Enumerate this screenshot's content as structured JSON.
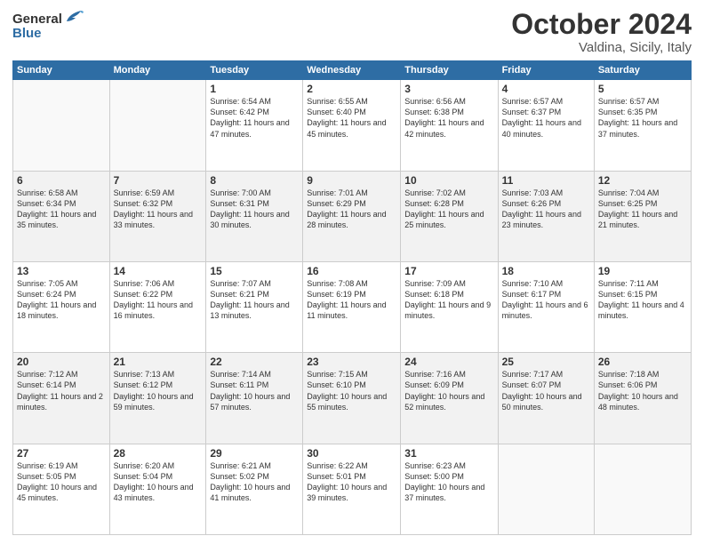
{
  "logo": {
    "general": "General",
    "blue": "Blue"
  },
  "header": {
    "month": "October 2024",
    "location": "Valdina, Sicily, Italy"
  },
  "days_of_week": [
    "Sunday",
    "Monday",
    "Tuesday",
    "Wednesday",
    "Thursday",
    "Friday",
    "Saturday"
  ],
  "weeks": [
    [
      {
        "day": "",
        "content": ""
      },
      {
        "day": "",
        "content": ""
      },
      {
        "day": "1",
        "content": "Sunrise: 6:54 AM\nSunset: 6:42 PM\nDaylight: 11 hours and 47 minutes."
      },
      {
        "day": "2",
        "content": "Sunrise: 6:55 AM\nSunset: 6:40 PM\nDaylight: 11 hours and 45 minutes."
      },
      {
        "day": "3",
        "content": "Sunrise: 6:56 AM\nSunset: 6:38 PM\nDaylight: 11 hours and 42 minutes."
      },
      {
        "day": "4",
        "content": "Sunrise: 6:57 AM\nSunset: 6:37 PM\nDaylight: 11 hours and 40 minutes."
      },
      {
        "day": "5",
        "content": "Sunrise: 6:57 AM\nSunset: 6:35 PM\nDaylight: 11 hours and 37 minutes."
      }
    ],
    [
      {
        "day": "6",
        "content": "Sunrise: 6:58 AM\nSunset: 6:34 PM\nDaylight: 11 hours and 35 minutes."
      },
      {
        "day": "7",
        "content": "Sunrise: 6:59 AM\nSunset: 6:32 PM\nDaylight: 11 hours and 33 minutes."
      },
      {
        "day": "8",
        "content": "Sunrise: 7:00 AM\nSunset: 6:31 PM\nDaylight: 11 hours and 30 minutes."
      },
      {
        "day": "9",
        "content": "Sunrise: 7:01 AM\nSunset: 6:29 PM\nDaylight: 11 hours and 28 minutes."
      },
      {
        "day": "10",
        "content": "Sunrise: 7:02 AM\nSunset: 6:28 PM\nDaylight: 11 hours and 25 minutes."
      },
      {
        "day": "11",
        "content": "Sunrise: 7:03 AM\nSunset: 6:26 PM\nDaylight: 11 hours and 23 minutes."
      },
      {
        "day": "12",
        "content": "Sunrise: 7:04 AM\nSunset: 6:25 PM\nDaylight: 11 hours and 21 minutes."
      }
    ],
    [
      {
        "day": "13",
        "content": "Sunrise: 7:05 AM\nSunset: 6:24 PM\nDaylight: 11 hours and 18 minutes."
      },
      {
        "day": "14",
        "content": "Sunrise: 7:06 AM\nSunset: 6:22 PM\nDaylight: 11 hours and 16 minutes."
      },
      {
        "day": "15",
        "content": "Sunrise: 7:07 AM\nSunset: 6:21 PM\nDaylight: 11 hours and 13 minutes."
      },
      {
        "day": "16",
        "content": "Sunrise: 7:08 AM\nSunset: 6:19 PM\nDaylight: 11 hours and 11 minutes."
      },
      {
        "day": "17",
        "content": "Sunrise: 7:09 AM\nSunset: 6:18 PM\nDaylight: 11 hours and 9 minutes."
      },
      {
        "day": "18",
        "content": "Sunrise: 7:10 AM\nSunset: 6:17 PM\nDaylight: 11 hours and 6 minutes."
      },
      {
        "day": "19",
        "content": "Sunrise: 7:11 AM\nSunset: 6:15 PM\nDaylight: 11 hours and 4 minutes."
      }
    ],
    [
      {
        "day": "20",
        "content": "Sunrise: 7:12 AM\nSunset: 6:14 PM\nDaylight: 11 hours and 2 minutes."
      },
      {
        "day": "21",
        "content": "Sunrise: 7:13 AM\nSunset: 6:12 PM\nDaylight: 10 hours and 59 minutes."
      },
      {
        "day": "22",
        "content": "Sunrise: 7:14 AM\nSunset: 6:11 PM\nDaylight: 10 hours and 57 minutes."
      },
      {
        "day": "23",
        "content": "Sunrise: 7:15 AM\nSunset: 6:10 PM\nDaylight: 10 hours and 55 minutes."
      },
      {
        "day": "24",
        "content": "Sunrise: 7:16 AM\nSunset: 6:09 PM\nDaylight: 10 hours and 52 minutes."
      },
      {
        "day": "25",
        "content": "Sunrise: 7:17 AM\nSunset: 6:07 PM\nDaylight: 10 hours and 50 minutes."
      },
      {
        "day": "26",
        "content": "Sunrise: 7:18 AM\nSunset: 6:06 PM\nDaylight: 10 hours and 48 minutes."
      }
    ],
    [
      {
        "day": "27",
        "content": "Sunrise: 6:19 AM\nSunset: 5:05 PM\nDaylight: 10 hours and 45 minutes."
      },
      {
        "day": "28",
        "content": "Sunrise: 6:20 AM\nSunset: 5:04 PM\nDaylight: 10 hours and 43 minutes."
      },
      {
        "day": "29",
        "content": "Sunrise: 6:21 AM\nSunset: 5:02 PM\nDaylight: 10 hours and 41 minutes."
      },
      {
        "day": "30",
        "content": "Sunrise: 6:22 AM\nSunset: 5:01 PM\nDaylight: 10 hours and 39 minutes."
      },
      {
        "day": "31",
        "content": "Sunrise: 6:23 AM\nSunset: 5:00 PM\nDaylight: 10 hours and 37 minutes."
      },
      {
        "day": "",
        "content": ""
      },
      {
        "day": "",
        "content": ""
      }
    ]
  ]
}
